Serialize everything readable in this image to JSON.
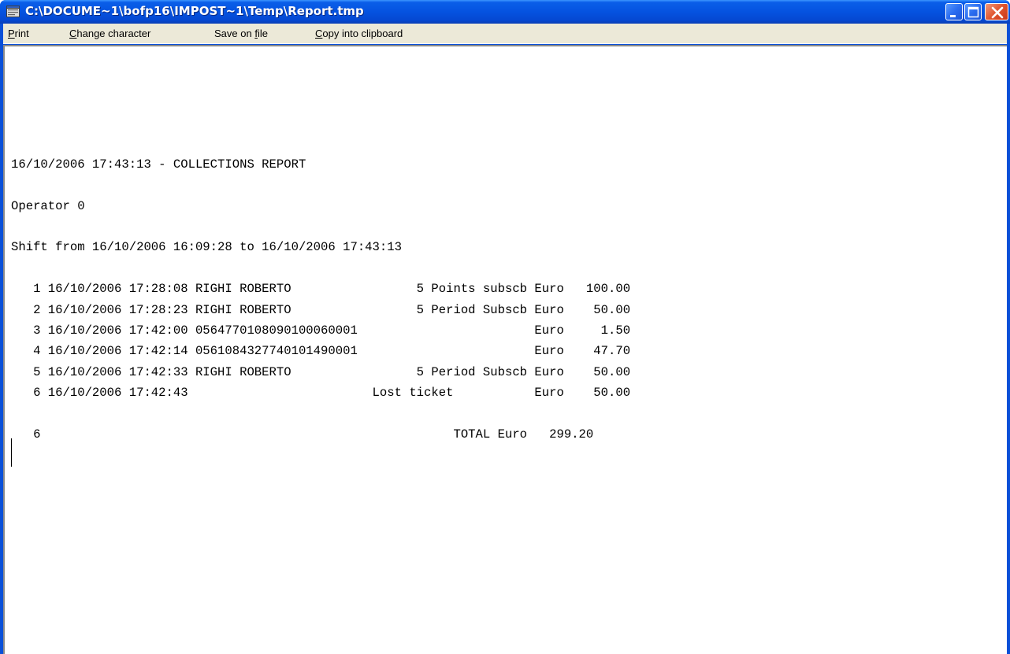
{
  "window": {
    "title": "C:\\DOCUME~1\\bofp16\\IMPOST~1\\Temp\\Report.tmp",
    "icon": "notepad-window-icon",
    "controls": [
      "minimize-icon",
      "maximize-icon",
      "close-icon"
    ],
    "colors": {
      "titlebar": "#0553e0",
      "menubar": "#ece9d8",
      "close": "#e0552e"
    }
  },
  "menu": {
    "print": {
      "label_u": "P",
      "label_rest": "rint"
    },
    "change_character": {
      "label_u": "C",
      "label_rest": "hange character"
    },
    "save_on_file": {
      "label_pre": "Save on ",
      "label_u": "f",
      "label_rest": "ile"
    },
    "copy_clipboard": {
      "label_u": "C",
      "label_rest": "opy into clipboard"
    }
  },
  "report": {
    "header": "16/10/2006 17:43:13 - COLLECTIONS REPORT",
    "operator": "Operator 0",
    "shift": "Shift from 16/10/2006 16:09:28 to 16/10/2006 17:43:13",
    "rows": [
      "   1 16/10/2006 17:28:08 RIGHI ROBERTO                 5 Points subscb Euro   100.00",
      "   2 16/10/2006 17:28:23 RIGHI ROBERTO                 5 Period Subscb Euro    50.00",
      "   3 16/10/2006 17:42:00 0564770108090100060001                        Euro     1.50",
      "   4 16/10/2006 17:42:14 0561084327740101490001                        Euro    47.70",
      "   5 16/10/2006 17:42:33 RIGHI ROBERTO                 5 Period Subscb Euro    50.00",
      "   6 16/10/2006 17:42:43                         Lost ticket           Euro    50.00"
    ],
    "total_line": "   6                                                        TOTAL Euro   299.20"
  }
}
